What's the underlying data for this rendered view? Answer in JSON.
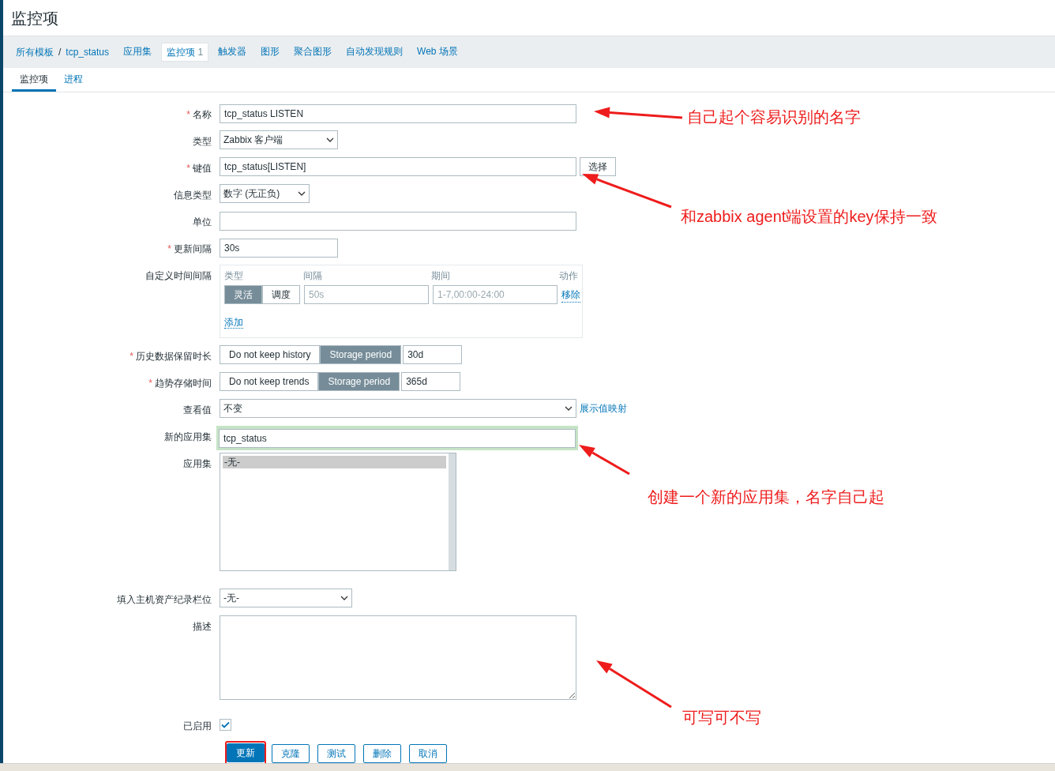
{
  "page_title": "监控项",
  "breadcrumbs": [
    {
      "label": "所有模板"
    },
    {
      "label": "tcp_status"
    }
  ],
  "breadcrumb_separator": "/",
  "nav_tabs": [
    {
      "label": "应用集",
      "selected": false
    },
    {
      "label": "监控项",
      "count": "1",
      "selected": true
    },
    {
      "label": "触发器",
      "selected": false
    },
    {
      "label": "图形",
      "selected": false
    },
    {
      "label": "聚合图形",
      "selected": false
    },
    {
      "label": "自动发现规则",
      "selected": false
    },
    {
      "label": "Web 场景",
      "selected": false
    }
  ],
  "sub_tabs": [
    {
      "label": "监控项",
      "selected": true
    },
    {
      "label": "进程",
      "selected": false
    }
  ],
  "fields": [
    {
      "kind": "text",
      "label": "名称",
      "required_mark": "*",
      "value": "tcp_status LISTEN"
    },
    {
      "kind": "select",
      "label": "类型",
      "value": "Zabbix 客户端"
    },
    {
      "kind": "text_button",
      "label": "键值",
      "required_mark": "*",
      "value": "tcp_status[LISTEN]",
      "button": "选择"
    },
    {
      "kind": "select",
      "label": "信息类型",
      "value": "数字 (无正负)"
    },
    {
      "kind": "text",
      "label": "单位"
    },
    {
      "kind": "text",
      "label": "更新间隔",
      "required_mark": "*",
      "value": "30s"
    },
    {
      "kind": "interval",
      "label": "自定义时间间隔",
      "headers": [
        "类型",
        "间隔",
        "期间",
        "动作"
      ],
      "modes": [
        {
          "label": "灵活",
          "selected": true
        },
        {
          "label": "调度",
          "selected": false
        }
      ],
      "interval_placeholder": "50s",
      "period_placeholder": "1-7,00:00-24:00",
      "remove": "移除",
      "add": "添加"
    },
    {
      "kind": "storage",
      "label": "历史数据保留时长",
      "required_mark": "*",
      "options": [
        {
          "label": "Do not keep history",
          "selected": false
        },
        {
          "label": "Storage period",
          "selected": true
        }
      ],
      "value": "30d"
    },
    {
      "kind": "storage",
      "label": "趋势存储时间",
      "required_mark": "*",
      "options": [
        {
          "label": "Do not keep trends",
          "selected": false
        },
        {
          "label": "Storage period",
          "selected": true
        }
      ],
      "value": "365d"
    },
    {
      "kind": "select",
      "label": "查看值",
      "value": "不变",
      "link": "展示值映射"
    },
    {
      "kind": "text",
      "label": "新的应用集",
      "value": "tcp_status",
      "highlighted": true
    },
    {
      "kind": "listbox",
      "label": "应用集",
      "items": [
        {
          "label": "-无-",
          "selected": true
        }
      ]
    },
    {
      "kind": "select",
      "label": "填入主机资产纪录栏位",
      "value": "-无-"
    },
    {
      "kind": "textarea",
      "label": "描述"
    },
    {
      "kind": "checkbox",
      "label": "已启用",
      "checked": true
    }
  ],
  "buttons": [
    {
      "label": "更新",
      "primary": true,
      "highlighted": true
    },
    {
      "label": "克隆",
      "primary": false,
      "highlighted": false
    },
    {
      "label": "测试",
      "primary": false,
      "highlighted": false
    },
    {
      "label": "删除",
      "primary": false,
      "highlighted": false
    },
    {
      "label": "取消",
      "primary": false,
      "highlighted": false
    }
  ],
  "annotations": [
    {
      "text": "自己起个容易识别的名字"
    },
    {
      "text": "和zabbix agent端设置的key保持一致"
    },
    {
      "text": "创建一个新的应用集，名字自己起"
    },
    {
      "text": "可写可不写"
    }
  ]
}
